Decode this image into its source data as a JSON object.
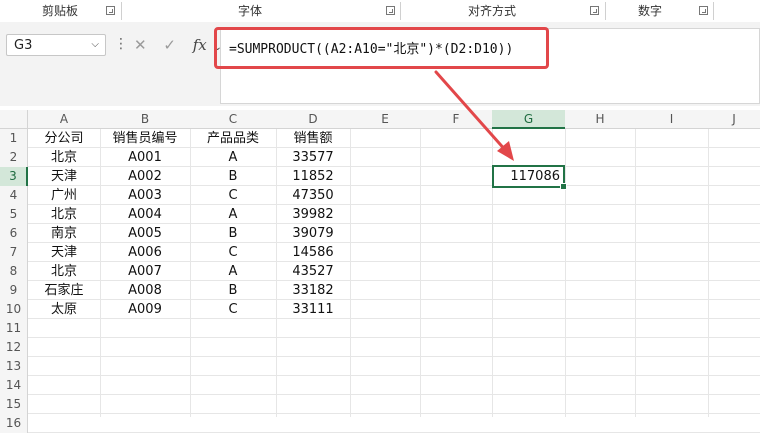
{
  "ribbon": {
    "groups": [
      "剪贴板",
      "字体",
      "对齐方式",
      "数字"
    ]
  },
  "formula_bar": {
    "name_box": "G3",
    "fx_label": "fx",
    "formula": "=SUMPRODUCT((A2:A10=\"北京\")*(D2:D10))"
  },
  "sheet": {
    "columns": [
      "A",
      "B",
      "C",
      "D",
      "E",
      "F",
      "G",
      "H",
      "I",
      "J"
    ],
    "rows": [
      "1",
      "2",
      "3",
      "4",
      "5",
      "6",
      "7",
      "8",
      "9",
      "10",
      "11",
      "12",
      "13",
      "14",
      "15",
      "16"
    ],
    "headers": [
      "分公司",
      "销售员编号",
      "产品品类",
      "销售额"
    ],
    "data": [
      [
        "北京",
        "A001",
        "A",
        "33577"
      ],
      [
        "天津",
        "A002",
        "B",
        "11852"
      ],
      [
        "广州",
        "A003",
        "C",
        "47350"
      ],
      [
        "北京",
        "A004",
        "A",
        "39982"
      ],
      [
        "南京",
        "A005",
        "B",
        "39079"
      ],
      [
        "天津",
        "A006",
        "C",
        "14586"
      ],
      [
        "北京",
        "A007",
        "A",
        "43527"
      ],
      [
        "石家庄",
        "A008",
        "B",
        "33182"
      ],
      [
        "太原",
        "A009",
        "C",
        "33111"
      ]
    ],
    "selected_cell_value": "117086"
  },
  "colors": {
    "selection": "#217346",
    "annotation": "#e2474a"
  }
}
